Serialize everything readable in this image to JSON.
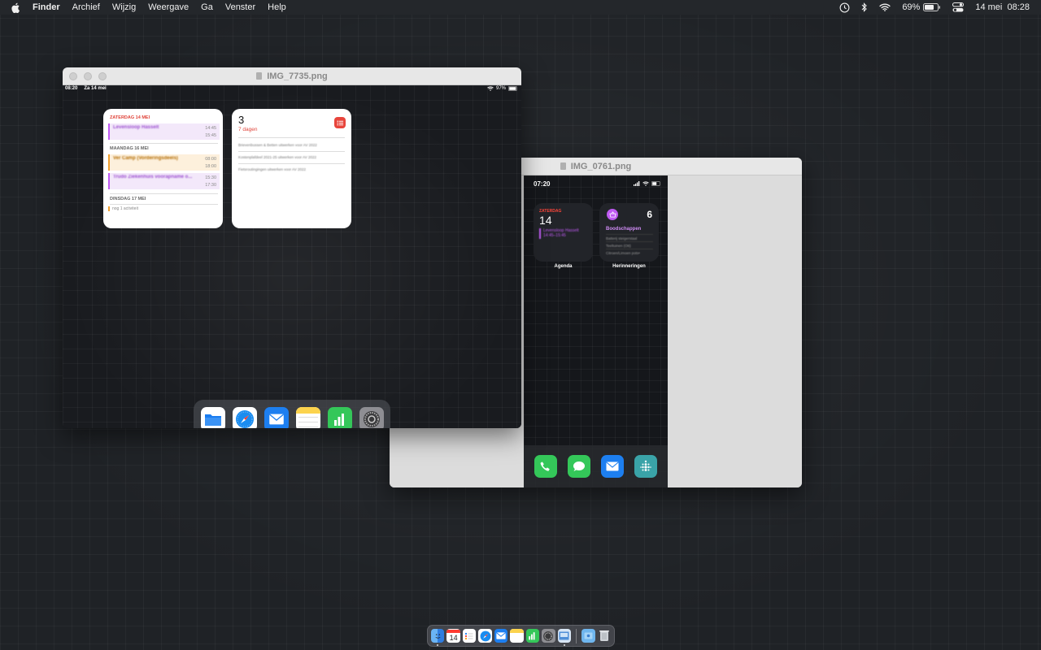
{
  "menubar": {
    "app_name": "Finder",
    "menus": [
      "Archief",
      "Wijzig",
      "Weergave",
      "Ga",
      "Venster",
      "Help"
    ],
    "battery_percent": "69%",
    "datetime": "14 mei  08:28"
  },
  "window_ipad": {
    "title": "IMG_7735.png",
    "statusbar": {
      "time": "08:20",
      "date": "Za 14 mei",
      "battery": "97%"
    },
    "calendar_widget": {
      "sections": [
        {
          "header": "ZATERDAG 14 MEI",
          "events": [
            {
              "name": "Levensloop Hasselt",
              "start": "14:45",
              "end": "15:45",
              "color": "#bf5af2"
            }
          ]
        },
        {
          "header": "MAANDAG 16 MEI",
          "events": [
            {
              "name": "Ver Camp (Vorderingsdeels)",
              "start": "08:00",
              "end": "18:00",
              "color": "#f0a030"
            },
            {
              "name": "Trudo Ziekenhuis voorapname o...",
              "start": "15:30",
              "end": "17:30",
              "color": "#bf5af2"
            }
          ]
        },
        {
          "header": "DINSDAG 17 MEI",
          "note": "nog 1 activiteit"
        }
      ]
    },
    "reminders_widget": {
      "count": "3",
      "subtitle": "7 dagen",
      "items": [
        "Brievenbussen & Betten uitwerken voor AV 2022",
        "Kostenplafdeel 2021-25 uitwerken voor AV 2022",
        "Fietsroutingingen uitwerken voor AV 2022"
      ]
    },
    "dock_apps": [
      "files-icon",
      "safari-icon",
      "mail-icon",
      "notes-icon",
      "numbers-icon",
      "settings-icon"
    ]
  },
  "window_iphone": {
    "title": "IMG_0761.png",
    "statusbar": {
      "time": "07:20"
    },
    "agenda_widget": {
      "day": "ZATERDAG",
      "date": "14",
      "event_name": "Levensloop Hasselt",
      "event_time": "14:45–15:45",
      "label": "Agenda"
    },
    "reminders_widget": {
      "count": "6",
      "list_name": "Boodschappen",
      "items": [
        "Batterij steigerstaal",
        "Teeltuinen (Ott)",
        "Citroen/Limoen pots•"
      ],
      "label": "Herinneringen"
    },
    "dock_apps": [
      "phone-icon",
      "messages-icon",
      "mail-icon",
      "fitbit-icon"
    ]
  },
  "mac_dock": {
    "calendar_date": "14",
    "apps": [
      "finder-icon",
      "calendar-icon",
      "reminders-icon",
      "safari-icon",
      "mail-icon",
      "notes-icon",
      "numbers-icon",
      "settings-icon",
      "preview-icon",
      "downloads-icon",
      "trash-icon"
    ]
  },
  "colors": {
    "accent_red": "#ff453a",
    "reminder_purple": "#bf5af2",
    "menubar": "#24272b"
  }
}
